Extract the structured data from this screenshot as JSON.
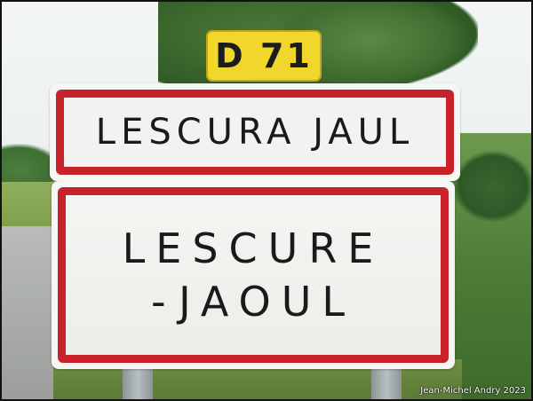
{
  "route_plate": {
    "text": "D 71"
  },
  "sign_top": {
    "text": "LESCURA JAUL"
  },
  "sign_bottom": {
    "line1": "LESCURE",
    "line2": "-JAOUL"
  },
  "credit": {
    "text": "Jean-Michel Andry 2023"
  },
  "colors": {
    "sign_border": "#c8222b",
    "route_plate": "#f1d62b",
    "sign_background": "#f2f3f1"
  }
}
